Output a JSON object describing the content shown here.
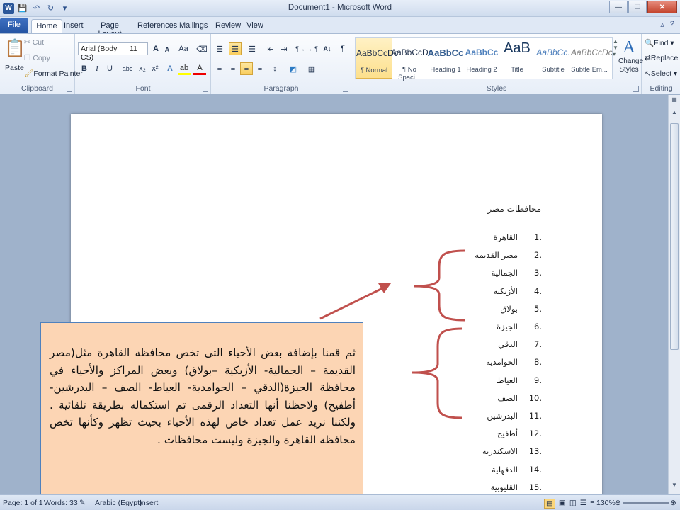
{
  "window": {
    "title": "Document1 - Microsoft Word",
    "title_faint": "Page"
  },
  "qat": {
    "app_icon": "W",
    "save": "save-icon",
    "undo": "undo-icon",
    "redo": "redo-icon"
  },
  "tabs": [
    "File",
    "Home",
    "Insert",
    "Page Layout",
    "References",
    "Mailings",
    "Review",
    "View"
  ],
  "active_tab": "Home",
  "clipboard": {
    "paste": "Paste",
    "cut": "Cut",
    "copy": "Copy",
    "format_painter": "Format Painter",
    "label": "Clipboard"
  },
  "font": {
    "name": "Arial (Body CS)",
    "size": "11",
    "label": "Font",
    "grow": "A",
    "shrink": "A",
    "case": "Aa",
    "bold": "B",
    "italic": "I",
    "underline": "U",
    "strike": "abc",
    "sub": "x₂",
    "sup": "x²"
  },
  "paragraph": {
    "label": "Paragraph",
    "pilcrow": "¶"
  },
  "styles": {
    "label": "Styles",
    "items": [
      {
        "preview": "AaBbCcDc",
        "name": "¶ Normal"
      },
      {
        "preview": "AaBbCcDc",
        "name": "¶ No Spaci..."
      },
      {
        "preview": "AaBbCc",
        "name": "Heading 1"
      },
      {
        "preview": "AaBbCc",
        "name": "Heading 2"
      },
      {
        "preview": "AaB",
        "name": "Title"
      },
      {
        "preview": "AaBbCc.",
        "name": "Subtitle"
      },
      {
        "preview": "AaBbCcDc",
        "name": "Subtle Em..."
      }
    ],
    "change_styles": "Change Styles"
  },
  "editing": {
    "label": "Editing",
    "find": "Find",
    "replace": "Replace",
    "select": "Select"
  },
  "document": {
    "heading": "محافظات مصر",
    "list": [
      {
        "n": "1.",
        "t": "القاهرة"
      },
      {
        "n": "2.",
        "t": "مصر القديمة"
      },
      {
        "n": "3.",
        "t": "الجمالية"
      },
      {
        "n": "4.",
        "t": "الأزبكية"
      },
      {
        "n": "5.",
        "t": "بولاق"
      },
      {
        "n": "6.",
        "t": "الجيزة"
      },
      {
        "n": "7.",
        "t": "الدقي"
      },
      {
        "n": "8.",
        "t": "الحوامدية"
      },
      {
        "n": "9.",
        "t": "العياط"
      },
      {
        "n": "10.",
        "t": "الصف"
      },
      {
        "n": "11.",
        "t": "البدرشين"
      },
      {
        "n": "12.",
        "t": "أطفيح"
      },
      {
        "n": "13.",
        "t": "الاسكندرية"
      },
      {
        "n": "14.",
        "t": "الدقهلية"
      },
      {
        "n": "15.",
        "t": "القليوبية"
      }
    ]
  },
  "callout": {
    "text": "ثم قمنا بإضافة بعض الأحياء التى تخص محافظة القاهرة مثل(مصر القديمة – الجمالية- الأزبكية –بولاق) وبعض المراكز والأحياء في محافظة الجيزة(الدقي – الحوامدية- العياط- الصف – البدرشين- أطفيح) ولاحظنا أنها التعداد الرقمى تم استكماله بطريقة تلقائية . ولكننا نريد عمل تعداد خاص لهذه الأحياء بحيث تظهر وكأنها تخص محافظة القاهرة والجيزة وليست محافظات .",
    "bg": "#fcd5b4",
    "border": "#4f81bd"
  },
  "annotation_color": "#c0504d",
  "status": {
    "page": "Page: 1 of 1",
    "words": "Words: 33",
    "language": "Arabic (Egypt)",
    "mode": "Insert",
    "zoom": "130%"
  }
}
